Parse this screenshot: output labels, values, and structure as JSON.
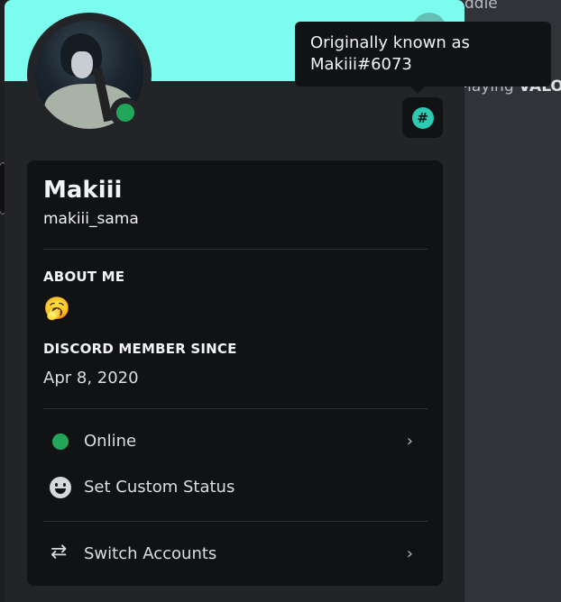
{
  "background": {
    "middle_text": "ddle",
    "playing_prefix": "-laying ",
    "playing_game": "VALO"
  },
  "profile": {
    "display_name": "Makiii",
    "username": "makiii_sama",
    "status": "online",
    "banner_color": "#7cfbef",
    "status_color": "#23a55a",
    "about_me_title": "ABOUT ME",
    "about_me_emoji": "🥱",
    "member_since_title": "DISCORD MEMBER SINCE",
    "member_since_date": "Apr 8, 2020"
  },
  "tooltip": {
    "text": "Originally known as\nMakiii#6073"
  },
  "menu": {
    "items": [
      {
        "label": "Online",
        "icon": "online-status-dot",
        "has_chevron": true
      },
      {
        "label": "Set Custom Status",
        "icon": "smile-icon",
        "has_chevron": false
      },
      {
        "label": "Switch Accounts",
        "icon": "switch-accounts-icon",
        "has_chevron": true
      }
    ]
  },
  "badges": [
    {
      "icon": "legacy-username-badge"
    }
  ]
}
